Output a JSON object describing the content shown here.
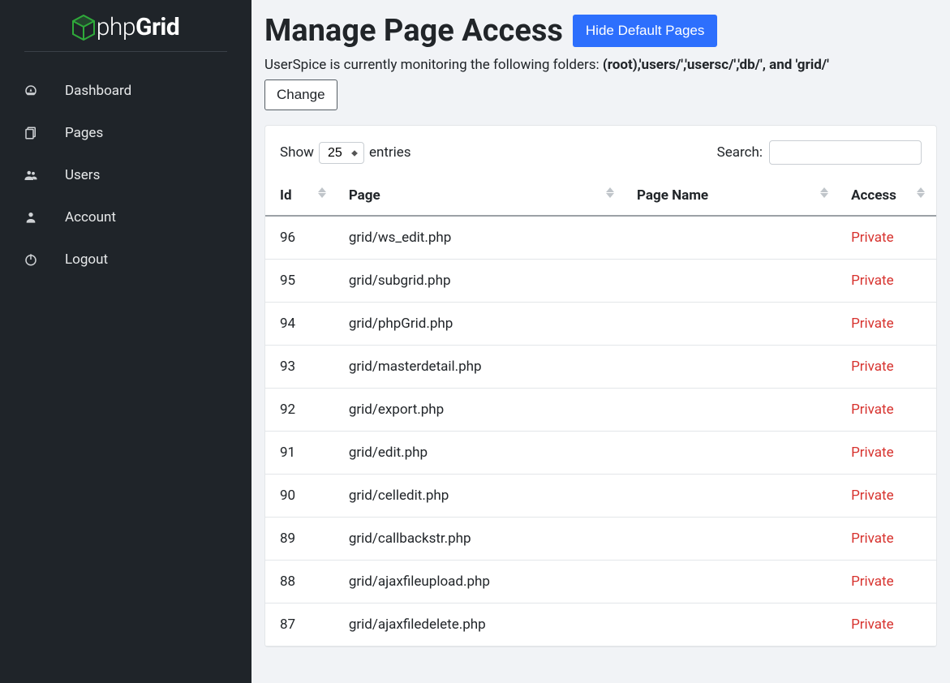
{
  "logo": {
    "prefix": "php",
    "suffix": "Grid"
  },
  "sidebar": {
    "items": [
      {
        "label": "Dashboard",
        "icon": "dashboard-icon"
      },
      {
        "label": "Pages",
        "icon": "pages-icon"
      },
      {
        "label": "Users",
        "icon": "users-icon"
      },
      {
        "label": "Account",
        "icon": "account-icon"
      },
      {
        "label": "Logout",
        "icon": "logout-icon"
      }
    ]
  },
  "header": {
    "title": "Manage Page Access",
    "hide_button_label": "Hide Default Pages"
  },
  "monitor": {
    "prefix": "UserSpice is currently monitoring the following folders: ",
    "folders": "(root),'users/','usersc/','db/', and 'grid/'",
    "change_label": "Change"
  },
  "datatable": {
    "show_label": "Show",
    "entries_label": "entries",
    "show_value": "25",
    "search_label": "Search:",
    "search_value": "",
    "columns": [
      "Id",
      "Page",
      "Page Name",
      "Access"
    ],
    "rows": [
      {
        "id": "96",
        "page": "grid/ws_edit.php",
        "name": "",
        "access": "Private"
      },
      {
        "id": "95",
        "page": "grid/subgrid.php",
        "name": "",
        "access": "Private"
      },
      {
        "id": "94",
        "page": "grid/phpGrid.php",
        "name": "",
        "access": "Private"
      },
      {
        "id": "93",
        "page": "grid/masterdetail.php",
        "name": "",
        "access": "Private"
      },
      {
        "id": "92",
        "page": "grid/export.php",
        "name": "",
        "access": "Private"
      },
      {
        "id": "91",
        "page": "grid/edit.php",
        "name": "",
        "access": "Private"
      },
      {
        "id": "90",
        "page": "grid/celledit.php",
        "name": "",
        "access": "Private"
      },
      {
        "id": "89",
        "page": "grid/callbackstr.php",
        "name": "",
        "access": "Private"
      },
      {
        "id": "88",
        "page": "grid/ajaxfileupload.php",
        "name": "",
        "access": "Private"
      },
      {
        "id": "87",
        "page": "grid/ajaxfiledelete.php",
        "name": "",
        "access": "Private"
      }
    ]
  }
}
